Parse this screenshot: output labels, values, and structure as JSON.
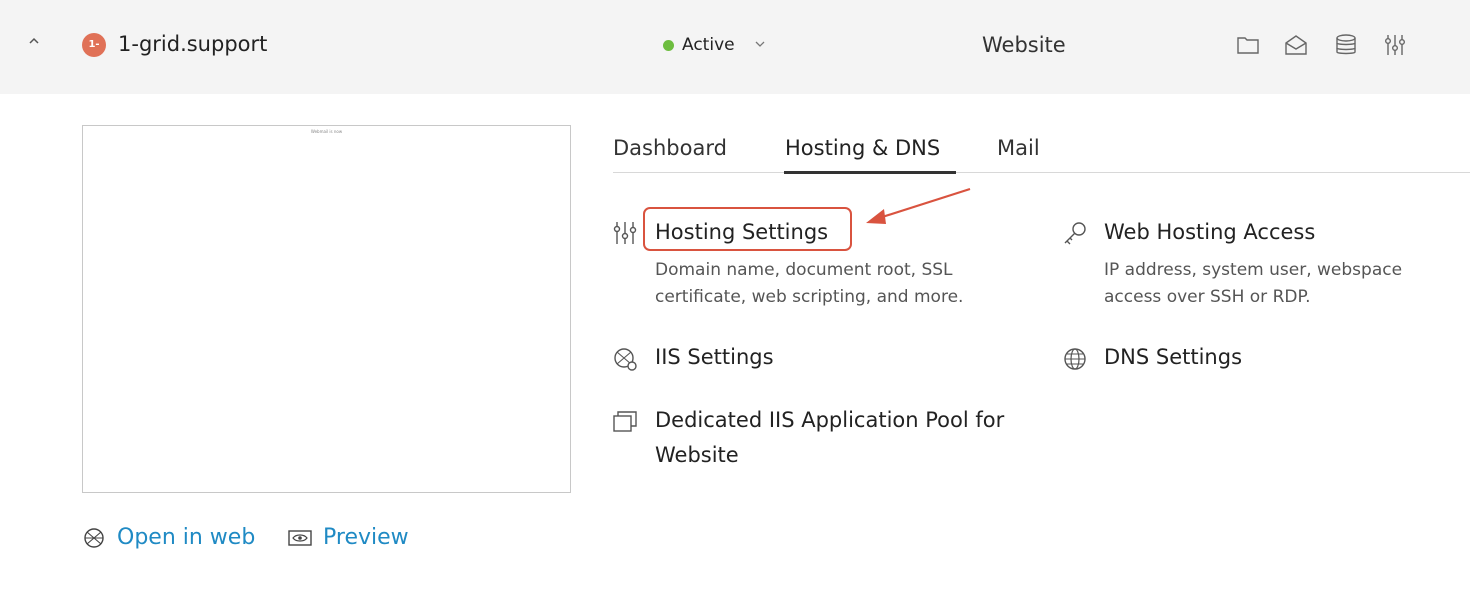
{
  "header": {
    "site_badge": "1-",
    "site_name": "1-grid.support",
    "status": "Active",
    "site_type": "Website",
    "icons": [
      "folder-icon",
      "mail-icon",
      "database-icon",
      "sliders-icon"
    ]
  },
  "preview": {
    "caption": "Webmail is now",
    "open_in_web_label": "Open in web",
    "preview_label": "Preview"
  },
  "tabs": [
    {
      "label": "Dashboard",
      "active": false
    },
    {
      "label": "Hosting & DNS",
      "active": true
    },
    {
      "label": "Mail",
      "active": false
    }
  ],
  "features": {
    "hosting_settings": {
      "title": "Hosting Settings",
      "desc_line1": "Domain name, document root, SSL",
      "desc_line2": "certificate, web scripting, and more."
    },
    "web_hosting_access": {
      "title": "Web Hosting Access",
      "desc_line1": "IP address, system user, webspace",
      "desc_line2": "access over SSH or RDP."
    },
    "iis_settings": {
      "title": "IIS Settings"
    },
    "dns_settings": {
      "title": "DNS Settings"
    },
    "app_pool": {
      "title_line1": "Dedicated IIS Application Pool for",
      "title_line2": "Website"
    }
  },
  "colors": {
    "accent_link": "#1f8ac4",
    "status_active": "#6dbd3f",
    "annotation": "#d9533f",
    "site_badge": "#e07157"
  }
}
